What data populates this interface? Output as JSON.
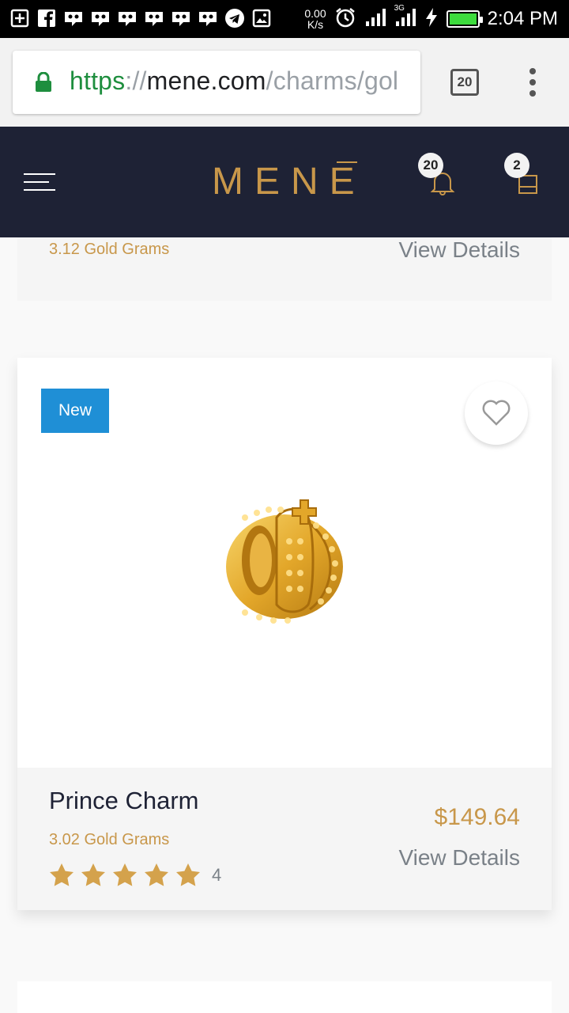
{
  "status_bar": {
    "net_speed_value": "0.00",
    "net_speed_unit": "K/s",
    "network_type": "3G",
    "time": "2:04 PM",
    "battery_color": "#3ddc3d"
  },
  "browser": {
    "url_scheme": "https",
    "url_sep": "://",
    "url_host": "mene.com",
    "url_path": "/charms/gol",
    "tab_count": "20",
    "secure_color": "#1e8e3e"
  },
  "site_header": {
    "logo": "MENE",
    "notification_count": "20",
    "cart_count": "2",
    "background": "#1e2235",
    "accent": "#c8974a"
  },
  "previous_product": {
    "grams": "3.12 Gold Grams",
    "view_details": "View Details"
  },
  "product": {
    "badge": "New",
    "name": "Prince Charm",
    "grams": "3.02 Gold Grams",
    "price": "$149.64",
    "view_details": "View Details",
    "rating_stars": 5,
    "review_count": "4",
    "badge_color": "#1f8fd6"
  }
}
